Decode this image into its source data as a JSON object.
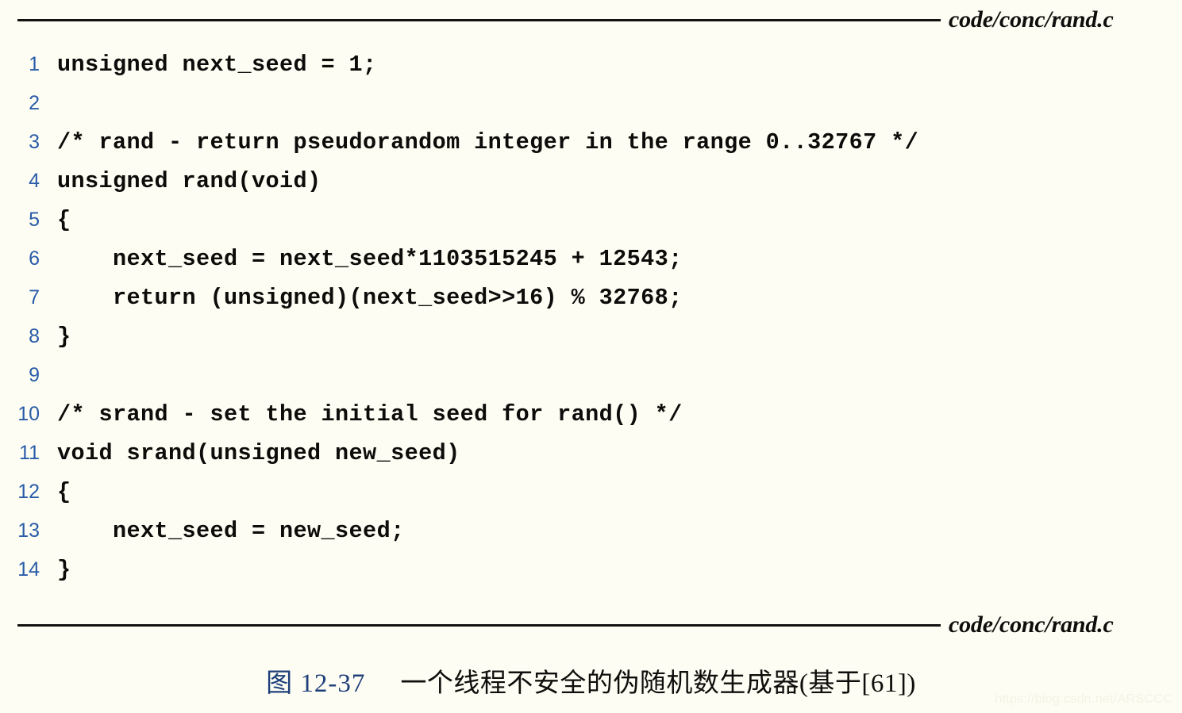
{
  "document": {
    "background_color": "#fdfdf3",
    "file_label_top": "code/conc/rand.c",
    "file_label_bottom": "code/conc/rand.c",
    "line_number_color": "#2a5ca8",
    "code_color": "#0d0c0a",
    "rule_color": "#141210"
  },
  "code": {
    "lines": [
      {
        "n": "1",
        "text": "unsigned next_seed = 1;"
      },
      {
        "n": "2",
        "text": ""
      },
      {
        "n": "3",
        "text": "/* rand - return pseudorandom integer in the range 0..32767 */"
      },
      {
        "n": "4",
        "text": "unsigned rand(void)"
      },
      {
        "n": "5",
        "text": "{"
      },
      {
        "n": "6",
        "text": "    next_seed = next_seed*1103515245 + 12543;"
      },
      {
        "n": "7",
        "text": "    return (unsigned)(next_seed>>16) % 32768;"
      },
      {
        "n": "8",
        "text": "}"
      },
      {
        "n": "9",
        "text": ""
      },
      {
        "n": "10",
        "text": "/* srand - set the initial seed for rand() */"
      },
      {
        "n": "11",
        "text": "void srand(unsigned new_seed)"
      },
      {
        "n": "12",
        "text": "{"
      },
      {
        "n": "13",
        "text": "    next_seed = new_seed;"
      },
      {
        "n": "14",
        "text": "}"
      }
    ]
  },
  "caption": {
    "number": "图 12-37",
    "number_color": "#1e3f7a",
    "text": "一个线程不安全的伪随机数生成器(基于[61])"
  },
  "watermark": {
    "text": "https://blog.csdn.net/ARSCCC"
  }
}
